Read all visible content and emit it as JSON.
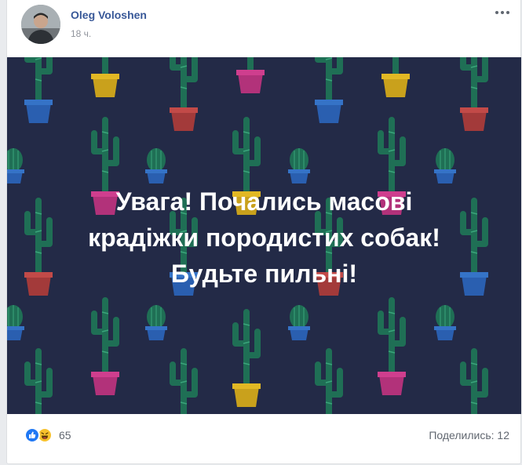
{
  "post": {
    "author": "Oleg Voloshen",
    "timestamp": "18 ч.",
    "text_lines": [
      "Увага! Почались масові",
      "крадіжки породистих собак!",
      "Будьте пильні!"
    ]
  },
  "reactions": {
    "icons": [
      "like-icon",
      "haha-icon"
    ],
    "count": "65"
  },
  "shares": "Поделились: 12",
  "colors": {
    "image_background": "#232a47",
    "cactus": "#1f6f55",
    "link": "#385898"
  }
}
